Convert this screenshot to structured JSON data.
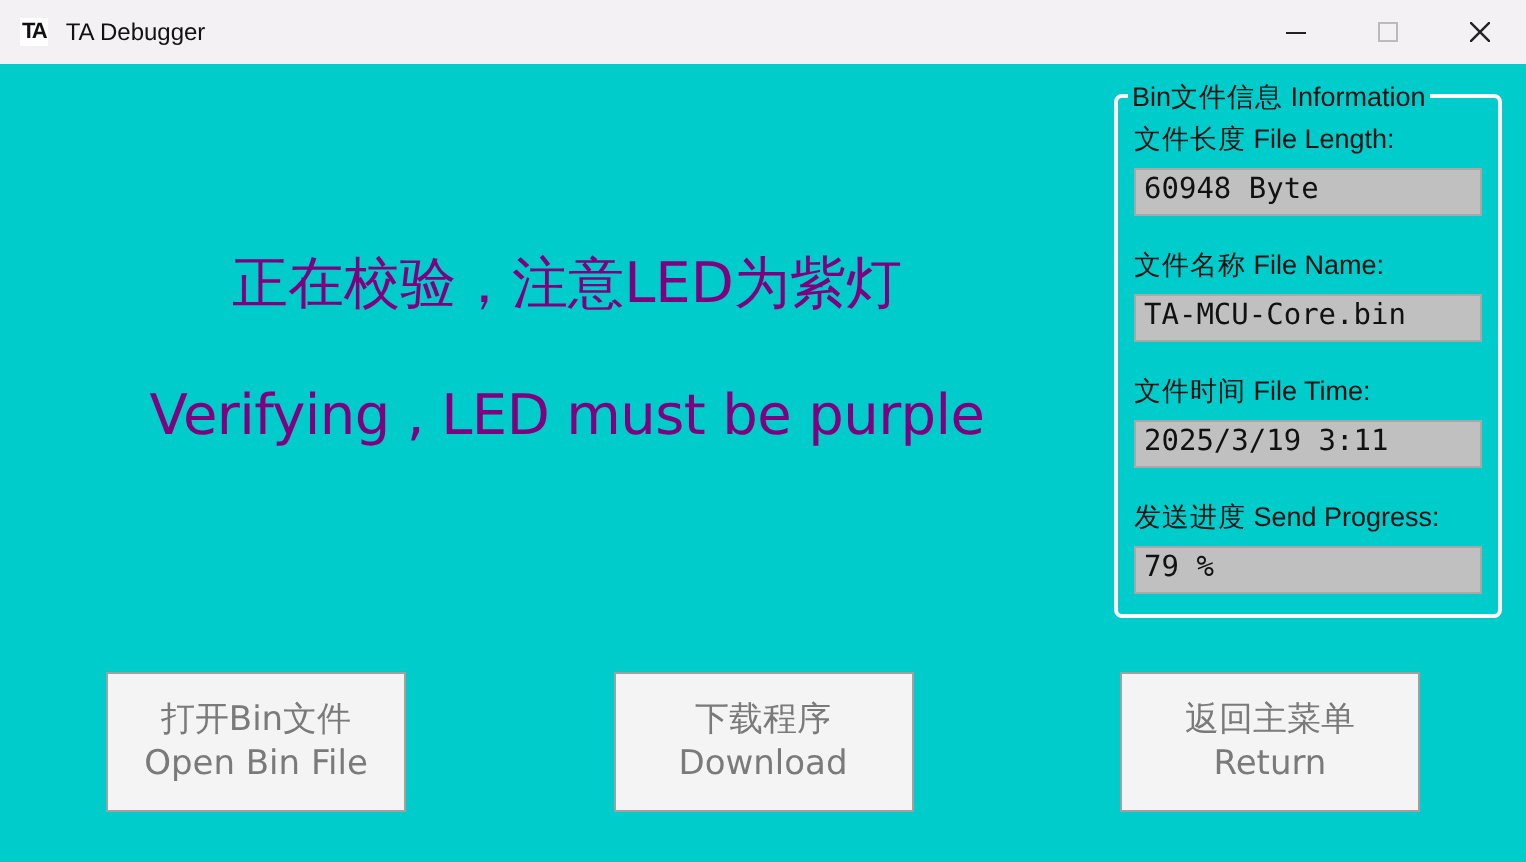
{
  "window": {
    "title": "TA Debugger",
    "logo": "TA"
  },
  "message": {
    "chinese": "正在校验，注意LED为紫灯",
    "english": "Verifying , LED must be purple"
  },
  "info": {
    "title": "Bin文件信息 Information",
    "fields": [
      {
        "label": "文件长度 File Length:",
        "value": "60948 Byte"
      },
      {
        "label": "文件名称 File Name:",
        "value": "TA-MCU-Core.bin"
      },
      {
        "label": "文件时间 File Time:",
        "value": "2025/3/19 3:11"
      },
      {
        "label": "发送进度 Send Progress:",
        "value": "79 %"
      }
    ]
  },
  "buttons": [
    {
      "chinese": "打开Bin文件",
      "english": "Open Bin File",
      "disabled": true
    },
    {
      "chinese": "下载程序",
      "english": "Download",
      "disabled": true
    },
    {
      "chinese": "返回主菜单",
      "english": "Return",
      "disabled": true
    }
  ]
}
